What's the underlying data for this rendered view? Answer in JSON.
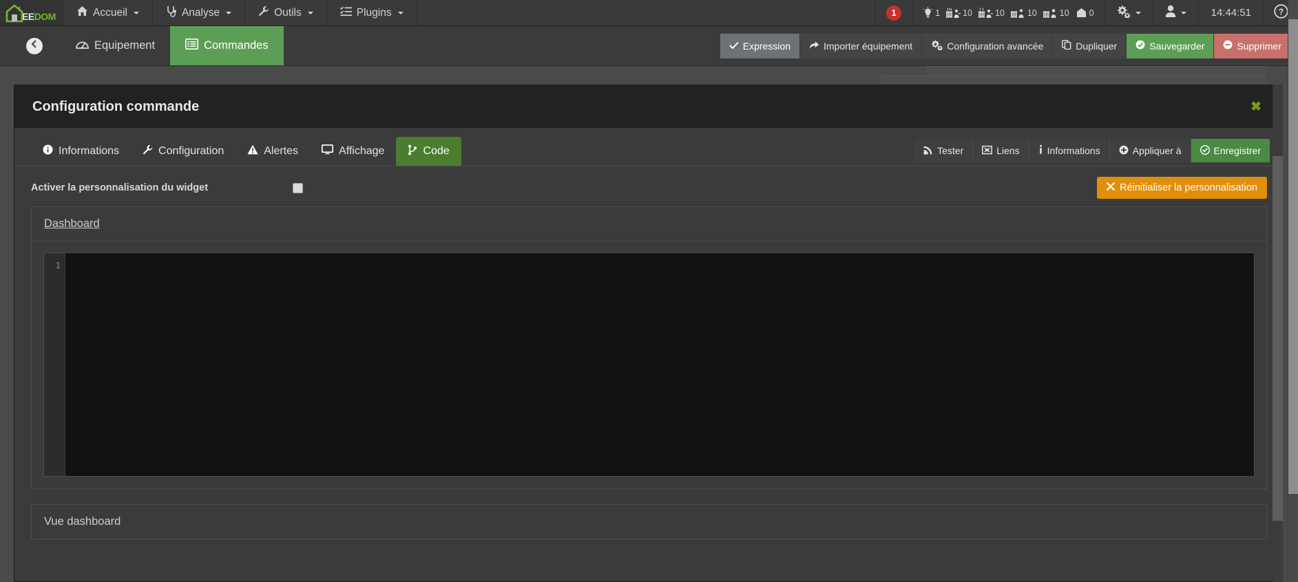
{
  "topnav": {
    "logo": {
      "ee": "EE",
      "dom": "DOM",
      "icon": "jeedom-house-logo"
    },
    "menu": [
      {
        "label": "Accueil",
        "icon": "home-icon",
        "has_caret": true
      },
      {
        "label": "Analyse",
        "icon": "stethoscope-icon",
        "has_caret": true
      },
      {
        "label": "Outils",
        "icon": "wrench-icon",
        "has_caret": true
      },
      {
        "label": "Plugins",
        "icon": "list-check-icon",
        "has_caret": true
      }
    ],
    "alert_badge": "1",
    "summary": [
      {
        "icon": "lightbulb-icon",
        "value": "1"
      },
      {
        "icon": "radiator-heating-icon",
        "value": "10"
      },
      {
        "icon": "radiator-cooling-icon",
        "value": "10"
      },
      {
        "icon": "radiator-power-icon",
        "value": "10"
      },
      {
        "icon": "radiator-outlet-icon",
        "value": "10"
      },
      {
        "icon": "house-security-icon",
        "value": "0"
      }
    ],
    "gear": {
      "icon": "gears-icon",
      "has_caret": true
    },
    "user": {
      "icon": "user-icon",
      "has_caret": true
    },
    "clock": "14:44:51",
    "help": {
      "icon": "question-circle-icon"
    }
  },
  "subbar": {
    "back": {
      "icon": "arrow-left-circle-icon"
    },
    "tabs": [
      {
        "label": "Equipement",
        "icon": "dashboard-gauge-icon",
        "active": false
      },
      {
        "label": "Commandes",
        "icon": "list-window-icon",
        "active": true
      }
    ],
    "buttons": [
      {
        "label": "Expression",
        "icon": "check-icon",
        "style": "pressed"
      },
      {
        "label": "Importer équipement",
        "icon": "share-arrow-icon",
        "style": "default"
      },
      {
        "label": "Configuration avancée",
        "icon": "cogs-icon",
        "style": "default"
      },
      {
        "label": "Dupliquer",
        "icon": "copy-icon",
        "style": "default"
      },
      {
        "label": "Sauvegarder",
        "icon": "check-circle-icon",
        "style": "green"
      },
      {
        "label": "Supprimer",
        "icon": "minus-circle-icon",
        "style": "red"
      }
    ]
  },
  "modal": {
    "title": "Configuration commande",
    "close_icon": "close-x-icon",
    "tabs": [
      {
        "label": "Informations",
        "icon": "info-circle-icon",
        "active": false
      },
      {
        "label": "Configuration",
        "icon": "wrench-icon",
        "active": false
      },
      {
        "label": "Alertes",
        "icon": "warning-triangle-icon",
        "active": false
      },
      {
        "label": "Affichage",
        "icon": "monitor-icon",
        "active": false
      },
      {
        "label": "Code",
        "icon": "code-branch-icon",
        "active": true
      }
    ],
    "actions": [
      {
        "label": "Tester",
        "icon": "rss-signal-icon",
        "style": "default"
      },
      {
        "label": "Liens",
        "icon": "sitemap-link-icon",
        "style": "default"
      },
      {
        "label": "Informations",
        "icon": "info-i-icon",
        "style": "default"
      },
      {
        "label": "Appliquer à",
        "icon": "plus-circle-icon",
        "style": "default"
      },
      {
        "label": "Enregistrer",
        "icon": "check-circle-icon",
        "style": "green"
      }
    ],
    "perso": {
      "label": "Activer la personnalisation du widget",
      "checkbox_checked": false,
      "reset_button": {
        "label": "Réinitialiser la personnalisation",
        "icon": "x-icon"
      }
    },
    "dashboard_panel": {
      "title": "Dashboard",
      "editor": {
        "line_numbers": [
          "1"
        ],
        "content": ""
      }
    },
    "vue_panel": {
      "title": "Vue dashboard"
    }
  },
  "colors": {
    "navbar_bg": "#3a3a3a",
    "accent_green": "#5d9e56",
    "tab_active_green": "#4b7d2f",
    "danger_red": "#c9302c",
    "delete_red": "#c9706b",
    "warning_orange": "#e08e0b",
    "logo_green": "#76b729",
    "close_olive": "#7a9c14",
    "page_bg": "#4a4a4a",
    "modal_bg": "#3b3b3b",
    "modal_head_bg": "#222222",
    "editor_bg": "#121212"
  }
}
